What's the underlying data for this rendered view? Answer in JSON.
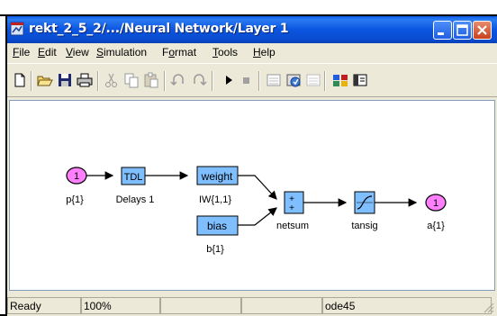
{
  "window": {
    "title": "rekt_2_5_2/.../Neural Network/Layer 1"
  },
  "menu": [
    {
      "first": "F",
      "rest": "ile"
    },
    {
      "first": "E",
      "rest": "dit"
    },
    {
      "first": "V",
      "rest": "iew"
    },
    {
      "first": "S",
      "rest": "imulation"
    },
    {
      "first": "",
      "pre": "F",
      "mid": "o",
      "post": "rmat"
    },
    {
      "first": "T",
      "rest": "ools"
    },
    {
      "first": "H",
      "rest": "elp"
    }
  ],
  "menu_labels": {
    "file": "File",
    "edit": "Edit",
    "view": "View",
    "simulation": "Simulation",
    "format": "Format",
    "tools": "Tools",
    "help": "Help"
  },
  "toolbar": {
    "icons": [
      "new-icon",
      "open-icon",
      "save-icon",
      "print-icon",
      "cut-icon",
      "copy-icon",
      "paste-icon",
      "undo-icon",
      "redo-icon",
      "play-icon",
      "stop-icon",
      "build-icon",
      "incremental-build-icon",
      "refresh-icon",
      "library-browser-icon",
      "model-explorer-icon"
    ]
  },
  "diagram": {
    "blocks": {
      "in1": {
        "number": "1",
        "label": "p{1}"
      },
      "tdl": {
        "text": "TDL",
        "label": "Delays 1"
      },
      "weight": {
        "text": "weight",
        "label": "IW{1,1}"
      },
      "bias": {
        "text": "bias",
        "label": "b{1}"
      },
      "netsum": {
        "text": "+\n+",
        "label": "netsum"
      },
      "tansig": {
        "label": "tansig"
      },
      "out1": {
        "number": "1",
        "label": "a{1}"
      }
    },
    "colors": {
      "port": "#ff7fff",
      "block": "#7fbfff",
      "line": "#000000"
    }
  },
  "status": {
    "state": "Ready",
    "zoom": "100%",
    "empty1": "",
    "empty2": "",
    "empty3": "",
    "solver": "ode45"
  },
  "colors": {
    "titlebar": "#0a55e0",
    "chrome": "#ece9d8"
  }
}
